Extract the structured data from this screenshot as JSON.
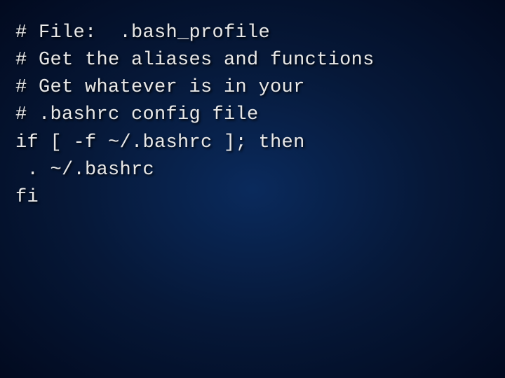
{
  "code": {
    "lines": [
      "# File:  .bash_profile",
      "# Get the aliases and functions",
      "# Get whatever is in your",
      "# .bashrc config file",
      "if [ -f ~/.bashrc ]; then",
      " . ~/.bashrc",
      "fi"
    ]
  }
}
